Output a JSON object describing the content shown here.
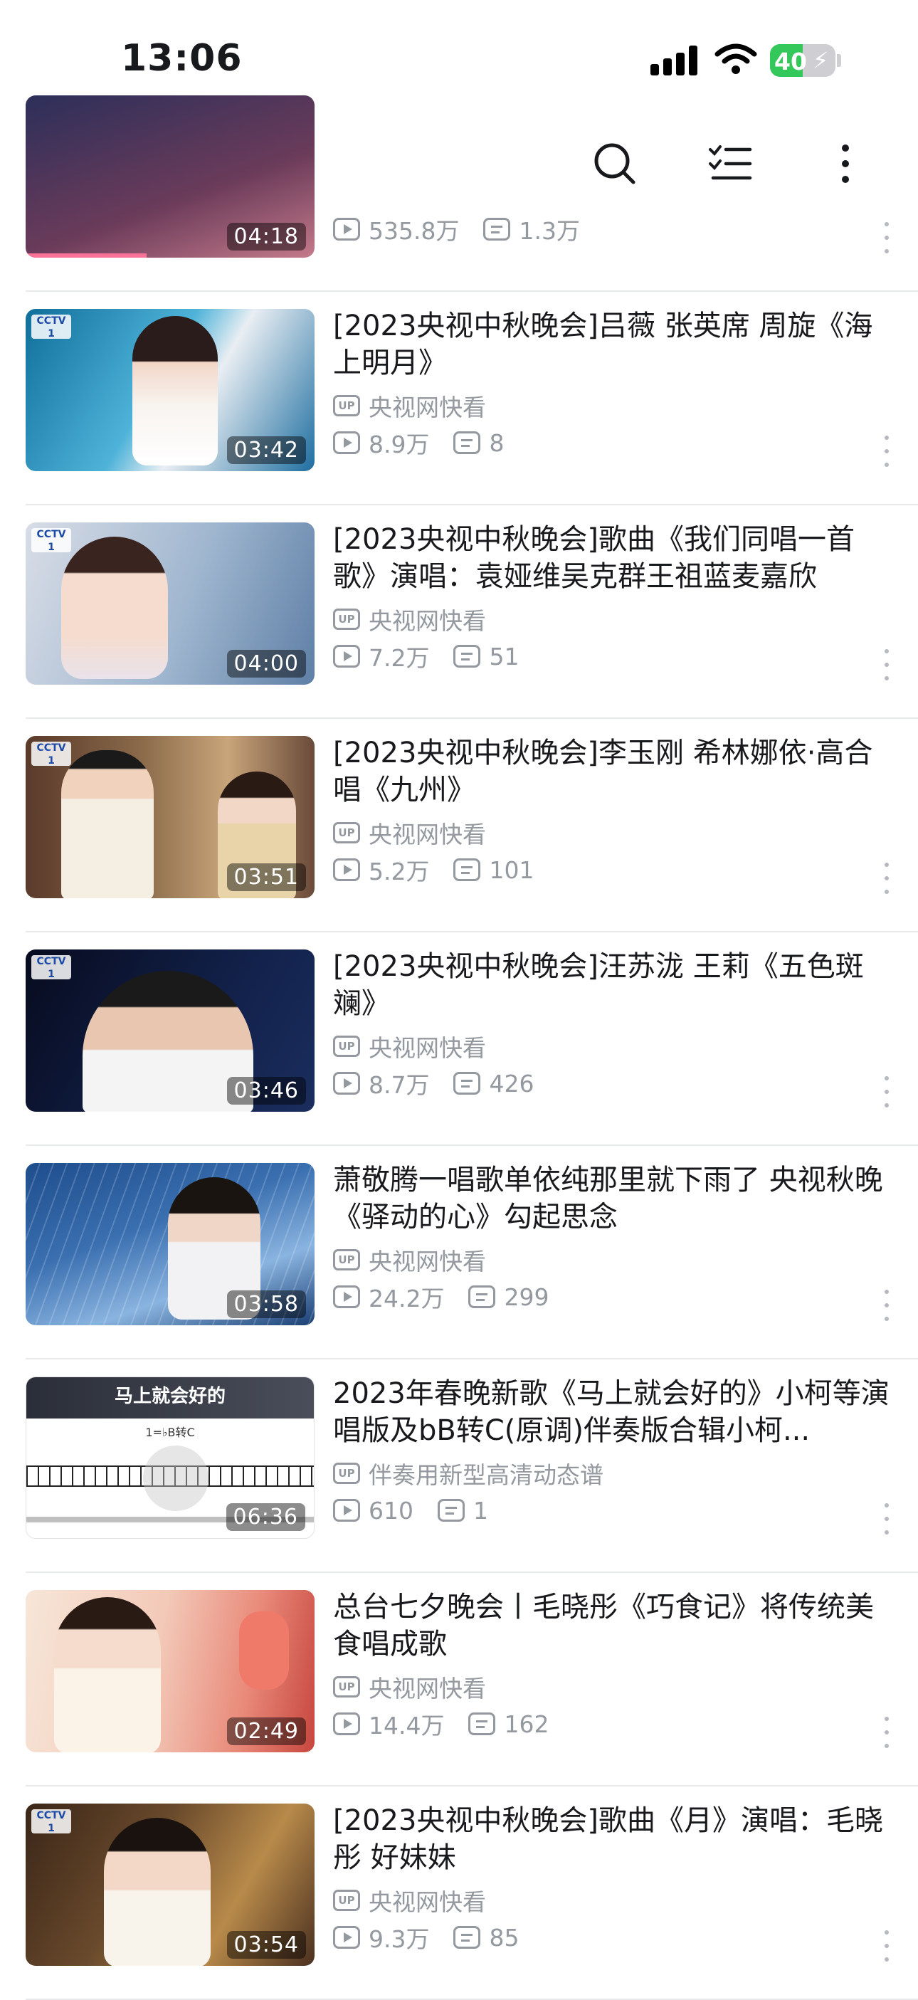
{
  "status": {
    "time": "13:06",
    "battery": "40"
  },
  "nav": {
    "back_icon": "chevron-left-icon",
    "search_icon": "search-icon",
    "select_icon": "checklist-icon",
    "more_icon": "more-vertical-icon"
  },
  "items": [
    {
      "title": "",
      "uploader": "",
      "views": "535.8万",
      "danmaku": "1.3万",
      "duration": "04:18"
    },
    {
      "title": "[2023央视中秋晚会]吕薇 张英席 周旋《海上明月》",
      "uploader": "央视网快看",
      "views": "8.9万",
      "danmaku": "8",
      "duration": "03:42"
    },
    {
      "title": "[2023央视中秋晚会]歌曲《我们同唱一首歌》演唱：袁娅维吴克群王祖蓝麦嘉欣",
      "uploader": "央视网快看",
      "views": "7.2万",
      "danmaku": "51",
      "duration": "04:00"
    },
    {
      "title": "[2023央视中秋晚会]李玉刚 希林娜依·高合唱《九州》",
      "uploader": "央视网快看",
      "views": "5.2万",
      "danmaku": "101",
      "duration": "03:51"
    },
    {
      "title": "[2023央视中秋晚会]汪苏泷 王莉《五色斑斓》",
      "uploader": "央视网快看",
      "views": "8.7万",
      "danmaku": "426",
      "duration": "03:46"
    },
    {
      "title": "萧敬腾一唱歌单依纯那里就下雨了  央视秋晚《驿动的心》勾起思念",
      "uploader": "央视网快看",
      "views": "24.2万",
      "danmaku": "299",
      "duration": "03:58"
    },
    {
      "title": "2023年春晚新歌《马上就会好的》小柯等演唱版及bB转C(原调)伴奏版合辑小柯...",
      "uploader": "伴奏用新型高清动态谱",
      "views": "610",
      "danmaku": "1",
      "duration": "06:36",
      "thumb_text": "马上就会好的",
      "thumb_key": "1=♭B转C"
    },
    {
      "title": "总台七夕晚会丨毛晓彤《巧食记》将传统美食唱成歌",
      "uploader": "央视网快看",
      "views": "14.4万",
      "danmaku": "162",
      "duration": "02:49"
    },
    {
      "title": "[2023央视中秋晚会]歌曲《月》演唱：毛晓彤 好妹妹",
      "uploader": "央视网快看",
      "views": "9.3万",
      "danmaku": "85",
      "duration": "03:54"
    }
  ],
  "colors": {
    "text": "#18191c",
    "meta": "#9499a0",
    "divider": "#e8e9eb",
    "battery": "#34c759"
  }
}
